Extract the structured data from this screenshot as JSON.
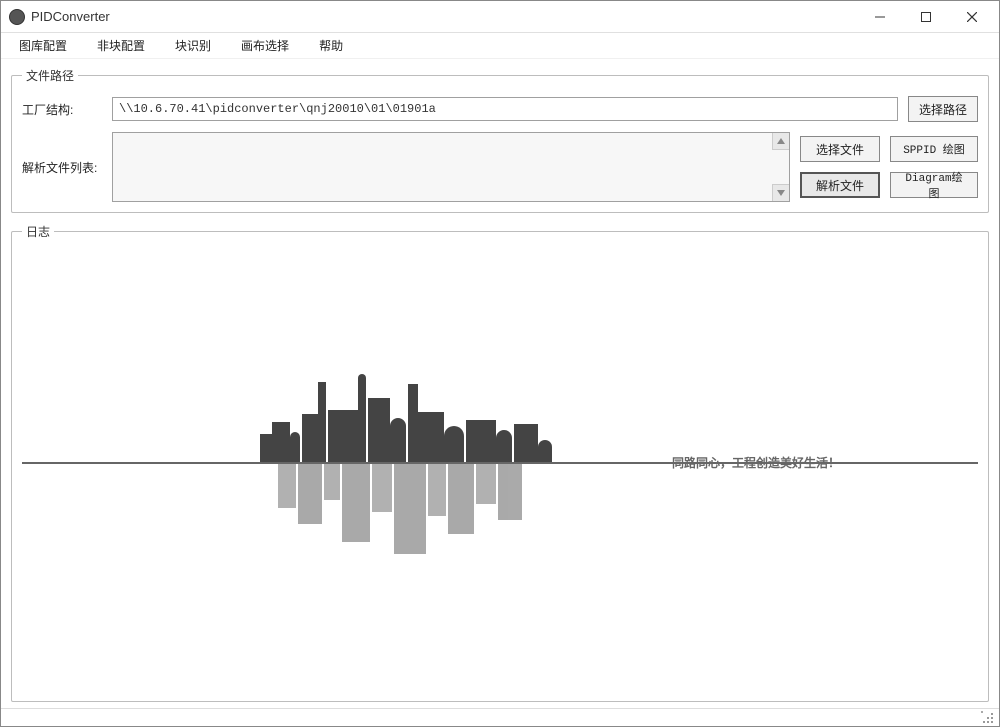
{
  "window": {
    "title": "PIDConverter"
  },
  "menu": {
    "items": [
      "图库配置",
      "非块配置",
      "块识别",
      "画布选择",
      "帮助"
    ]
  },
  "file_path_group": {
    "legend": "文件路径",
    "factory_label": "工厂结构:",
    "factory_path": "\\\\10.6.70.41\\pidconverter\\qnj20010\\01\\01901a",
    "select_path_btn": "选择路径",
    "parse_list_label": "解析文件列表:",
    "select_file_btn": "选择文件",
    "parse_file_btn": "解析文件",
    "sppid_btn": "SPPID 绘图",
    "diagram_btn": "Diagram绘图"
  },
  "log_group": {
    "legend": "日志",
    "slogan": "同路同心，工程创造美好生活！"
  }
}
